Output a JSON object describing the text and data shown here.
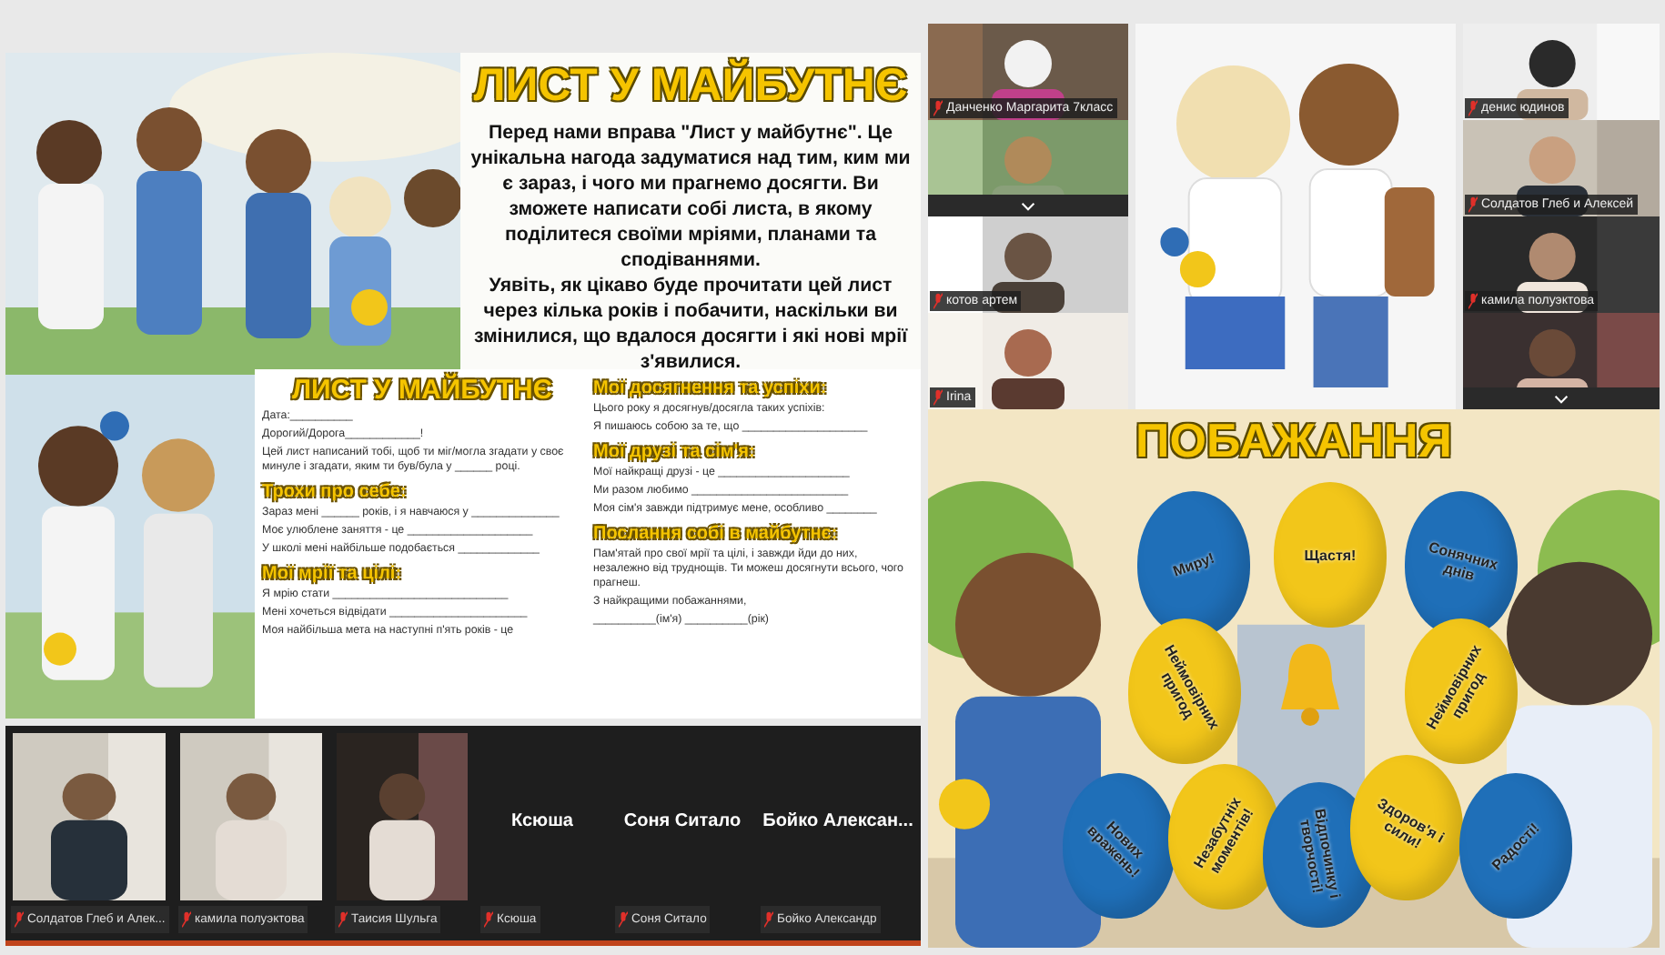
{
  "letter_slide": {
    "title": "ЛИСТ У МАЙБУТНЄ",
    "paragraphs": [
      "Перед нами вправа \"Лист у майбутнє\". Це унікальна нагода задуматися над тим, ким ми є зараз, і чого ми прагнемо досягти. Ви зможете написати собі листа, в якому поділитеся своїми мріями, планами та сподіваннями.",
      "Уявіть, як цікаво буде прочитати цей лист через кілька років і побачити, наскільки ви змінилися, що вдалося досягти і які нові мрії з'явилися."
    ]
  },
  "worksheet": {
    "title": "ЛИСТ У МАЙБУТНЄ",
    "columns": [
      [
        {
          "kind": "line",
          "text": "Дата:__________"
        },
        {
          "kind": "line",
          "text": "Дорогий/Дорога____________!"
        },
        {
          "kind": "line",
          "text": "Цей лист написаний тобі, щоб ти міг/могла згадати у своє минуле і згадати, яким ти був/була у ______ році."
        },
        {
          "kind": "heading",
          "text": "Трохи про себе:"
        },
        {
          "kind": "line",
          "text": "Зараз мені ______ років, і я навчаюся у ______________"
        },
        {
          "kind": "line",
          "text": "Моє улюблене заняття - це ____________________"
        },
        {
          "kind": "line",
          "text": "У школі мені найбільше подобається _____________"
        },
        {
          "kind": "heading",
          "text": "Мої мрії та цілі:"
        },
        {
          "kind": "line",
          "text": "Я мрію стати ____________________________"
        },
        {
          "kind": "line",
          "text": "Мені хочеться відвідати ______________________"
        },
        {
          "kind": "line",
          "text": "Моя найбільша мета на наступні п'ять років - це"
        }
      ],
      [
        {
          "kind": "heading",
          "text": "Мої досягнення та успіхи:"
        },
        {
          "kind": "line",
          "text": "Цього року я досягнув/досягла таких успіхів:"
        },
        {
          "kind": "line",
          "text": "Я пишаюсь собою за те, що ____________________"
        },
        {
          "kind": "heading",
          "text": "Мої друзі та сім'я:"
        },
        {
          "kind": "line",
          "text": "Мої найкращі друзі - це _____________________"
        },
        {
          "kind": "line",
          "text": "Ми разом любимо _________________________"
        },
        {
          "kind": "line",
          "text": "Моя сім'я завжди підтримує мене, особливо ________"
        },
        {
          "kind": "heading",
          "text": "Послання собі в майбутнє:"
        },
        {
          "kind": "line",
          "text": "Пам'ятай про свої мрії та цілі, і завжди йди до них, незалежно від труднощів. Ти можеш досягнути всього, чого прагнеш."
        },
        {
          "kind": "line",
          "text": "З найкращими побажаннями,"
        },
        {
          "kind": "line",
          "text": "__________(ім'я) __________(рік)"
        }
      ]
    ]
  },
  "gallery": [
    {
      "kind": "video",
      "name": "Солдатов Глеб и Алек..."
    },
    {
      "kind": "video",
      "name": "камила полуэктова"
    },
    {
      "kind": "video",
      "name": "Таисия Шульга"
    },
    {
      "kind": "avatar",
      "display": "Ксюша",
      "name": "Ксюша"
    },
    {
      "kind": "avatar",
      "display": "Соня Ситало",
      "name": "Соня Ситало"
    },
    {
      "kind": "avatar",
      "display": "Бойко Алексан...",
      "name": "Бойко Александр"
    }
  ],
  "left_tiles": [
    {
      "kind": "named",
      "name": "Данченко Маргарита 7класс"
    },
    {
      "kind": "collapsed"
    },
    {
      "kind": "named",
      "name": "котов артем"
    },
    {
      "kind": "named",
      "name": "Irina"
    }
  ],
  "right_tiles": [
    {
      "kind": "named",
      "name": "денис юдинов"
    },
    {
      "kind": "named",
      "name": "Солдатов Глеб и Алексей"
    },
    {
      "kind": "named",
      "name": "камила полуэктова"
    },
    {
      "kind": "collapsed"
    }
  ],
  "wishes_slide": {
    "title": "ПОБАЖАННЯ",
    "balloons": [
      {
        "text": "Миру!",
        "color": "#1f6fb8"
      },
      {
        "text": "Щастя!",
        "color": "#f2c61a"
      },
      {
        "text": "Сонячних днів",
        "color": "#1f6fb8"
      },
      {
        "text": "Неймовірних пригод",
        "color": "#f2c61a"
      },
      {
        "text": "Неймовірних пригод",
        "color": "#f2c61a"
      },
      {
        "text": "Нових вражень!",
        "color": "#1f6fb8"
      },
      {
        "text": "Незабутніх моментів!",
        "color": "#f2c61a"
      },
      {
        "text": "Відпочинку і творчості!",
        "color": "#1f6fb8"
      },
      {
        "text": "Здоров'я і сили!",
        "color": "#f2c61a"
      },
      {
        "text": "Радості!",
        "color": "#1f6fb8"
      }
    ]
  }
}
